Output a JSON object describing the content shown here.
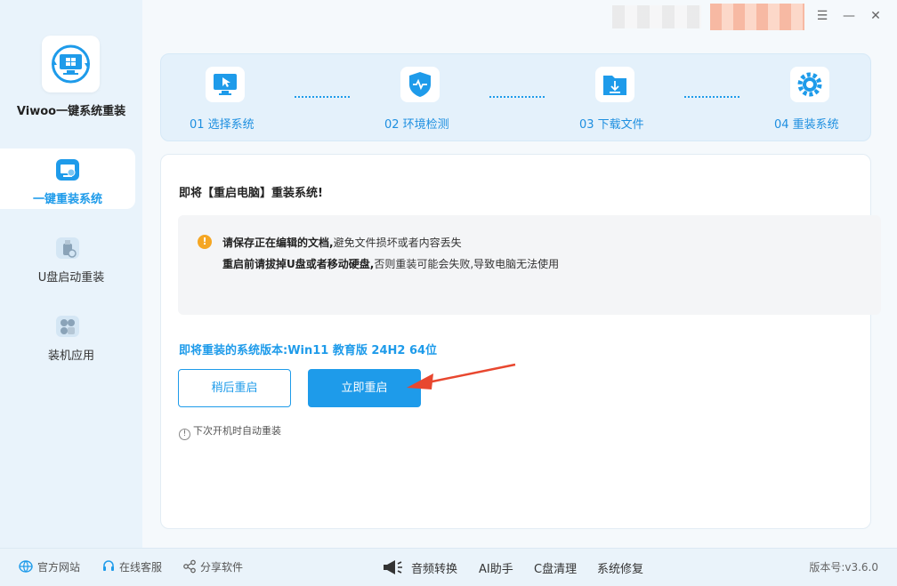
{
  "app": {
    "title": "Viwoo一键系统重装"
  },
  "sidebar": {
    "items": [
      {
        "label": "一键重装系统",
        "icon": "monitor-reinstall-icon",
        "active": true
      },
      {
        "label": "U盘启动重装",
        "icon": "usb-drive-icon",
        "active": false
      },
      {
        "label": "装机应用",
        "icon": "apps-grid-icon",
        "active": false
      }
    ]
  },
  "window": {
    "menu_icon": "menu-icon",
    "minimize_icon": "minimize-icon",
    "close_icon": "close-icon"
  },
  "steps": [
    {
      "label": "01 选择系统",
      "icon": "select-system-icon"
    },
    {
      "label": "02 环境检测",
      "icon": "shield-check-icon"
    },
    {
      "label": "03 下载文件",
      "icon": "download-folder-icon"
    },
    {
      "label": "04 重装系统",
      "icon": "gear-icon"
    }
  ],
  "main": {
    "headline": "即将【重启电脑】重装系统!",
    "notice": {
      "line1_bold": "请保存正在编辑的文档,",
      "line1_rest": "避免文件损坏或者内容丢失",
      "line2_bold": "重启前请拔掉U盘或者移动硬盘,",
      "line2_rest": "否则重装可能会失败,导致电脑无法使用"
    },
    "version_prefix": "即将重装的系统版本:",
    "version_value": "Win11 教育版 24H2 64位",
    "later_button": "稍后重启",
    "now_button": "立即重启",
    "auto_note": "下次开机时自动重装"
  },
  "footer": {
    "links": [
      {
        "label": "官方网站",
        "icon": "globe-icon"
      },
      {
        "label": "在线客服",
        "icon": "headset-icon"
      },
      {
        "label": "分享软件",
        "icon": "share-icon"
      }
    ],
    "tools": [
      "音频转换",
      "AI助手",
      "C盘清理",
      "系统修复"
    ],
    "version": "版本号:v3.6.0"
  },
  "colors": {
    "accent": "#1e9bea",
    "warning": "#f5a623",
    "arrow": "#e8472f"
  }
}
